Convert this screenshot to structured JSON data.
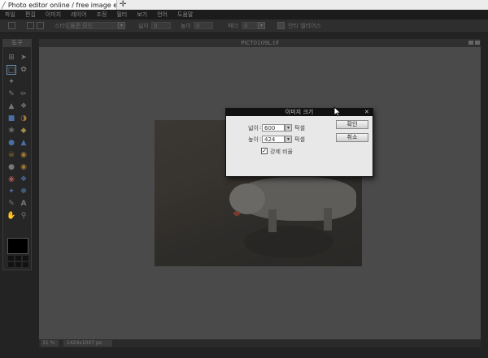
{
  "browser": {
    "tab_title": "Photo editor online / free image edi…",
    "new_tab_label": "✛"
  },
  "menu": {
    "items": [
      "파일",
      "편집",
      "이미지",
      "레이어",
      "조정",
      "필터",
      "보기",
      "언어",
      "도움말"
    ]
  },
  "options": {
    "style_label": "스타일",
    "style_value": "표준 모드",
    "width_label": "넓이",
    "width_value": "0",
    "height_label": "높이",
    "height_value": "0",
    "feather_label": "페더",
    "feather_value": "0",
    "antialias_label": "안티 엘리어스"
  },
  "toolbox": {
    "title": "도구"
  },
  "document": {
    "title": "PICT0109L.tif",
    "zoom": "31",
    "zoom_unit": "%",
    "size": "1424x1007 px"
  },
  "dialog": {
    "title": "이미지 크기",
    "width_label": "넓이",
    "width_value": "600",
    "width_unit": "픽셀",
    "height_label": "높이",
    "height_value": "424",
    "height_unit": "픽셀",
    "constrain_label": "강제 비율",
    "constrain_checked": true,
    "ok_label": "확인",
    "cancel_label": "취소"
  }
}
